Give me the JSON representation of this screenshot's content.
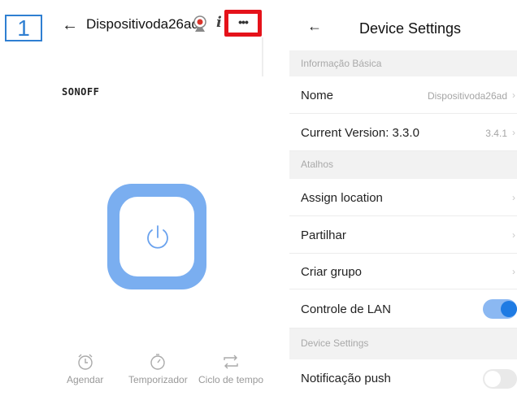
{
  "left": {
    "step_number": "1",
    "device_title": "Dispositivoda26ad",
    "info_glyph": "i",
    "more_glyph": "•••",
    "brand": "SONOFF",
    "tools": [
      {
        "label": "Agendar",
        "icon": "alarm-clock-icon"
      },
      {
        "label": "Temporizador",
        "icon": "stopwatch-icon"
      },
      {
        "label": "Ciclo de tempo",
        "icon": "loop-icon"
      }
    ],
    "power_color": "#7aaef0"
  },
  "right": {
    "title": "Device Settings",
    "sections": {
      "basic": "Informação Básica",
      "shortcuts": "Atalhos",
      "device": "Device Settings"
    },
    "rows": {
      "name": {
        "label": "Nome",
        "value": "Dispositivoda26ad"
      },
      "version": {
        "label": "Current Version: 3.3.0",
        "value": "3.4.1"
      },
      "location": {
        "label": "Assign location"
      },
      "share": {
        "label": "Partilhar"
      },
      "group": {
        "label": "Criar grupo"
      },
      "lan": {
        "label": "Controle de LAN",
        "on": true
      },
      "push": {
        "label": "Notificação push",
        "on": false
      }
    },
    "accent": "#1f7be3"
  }
}
